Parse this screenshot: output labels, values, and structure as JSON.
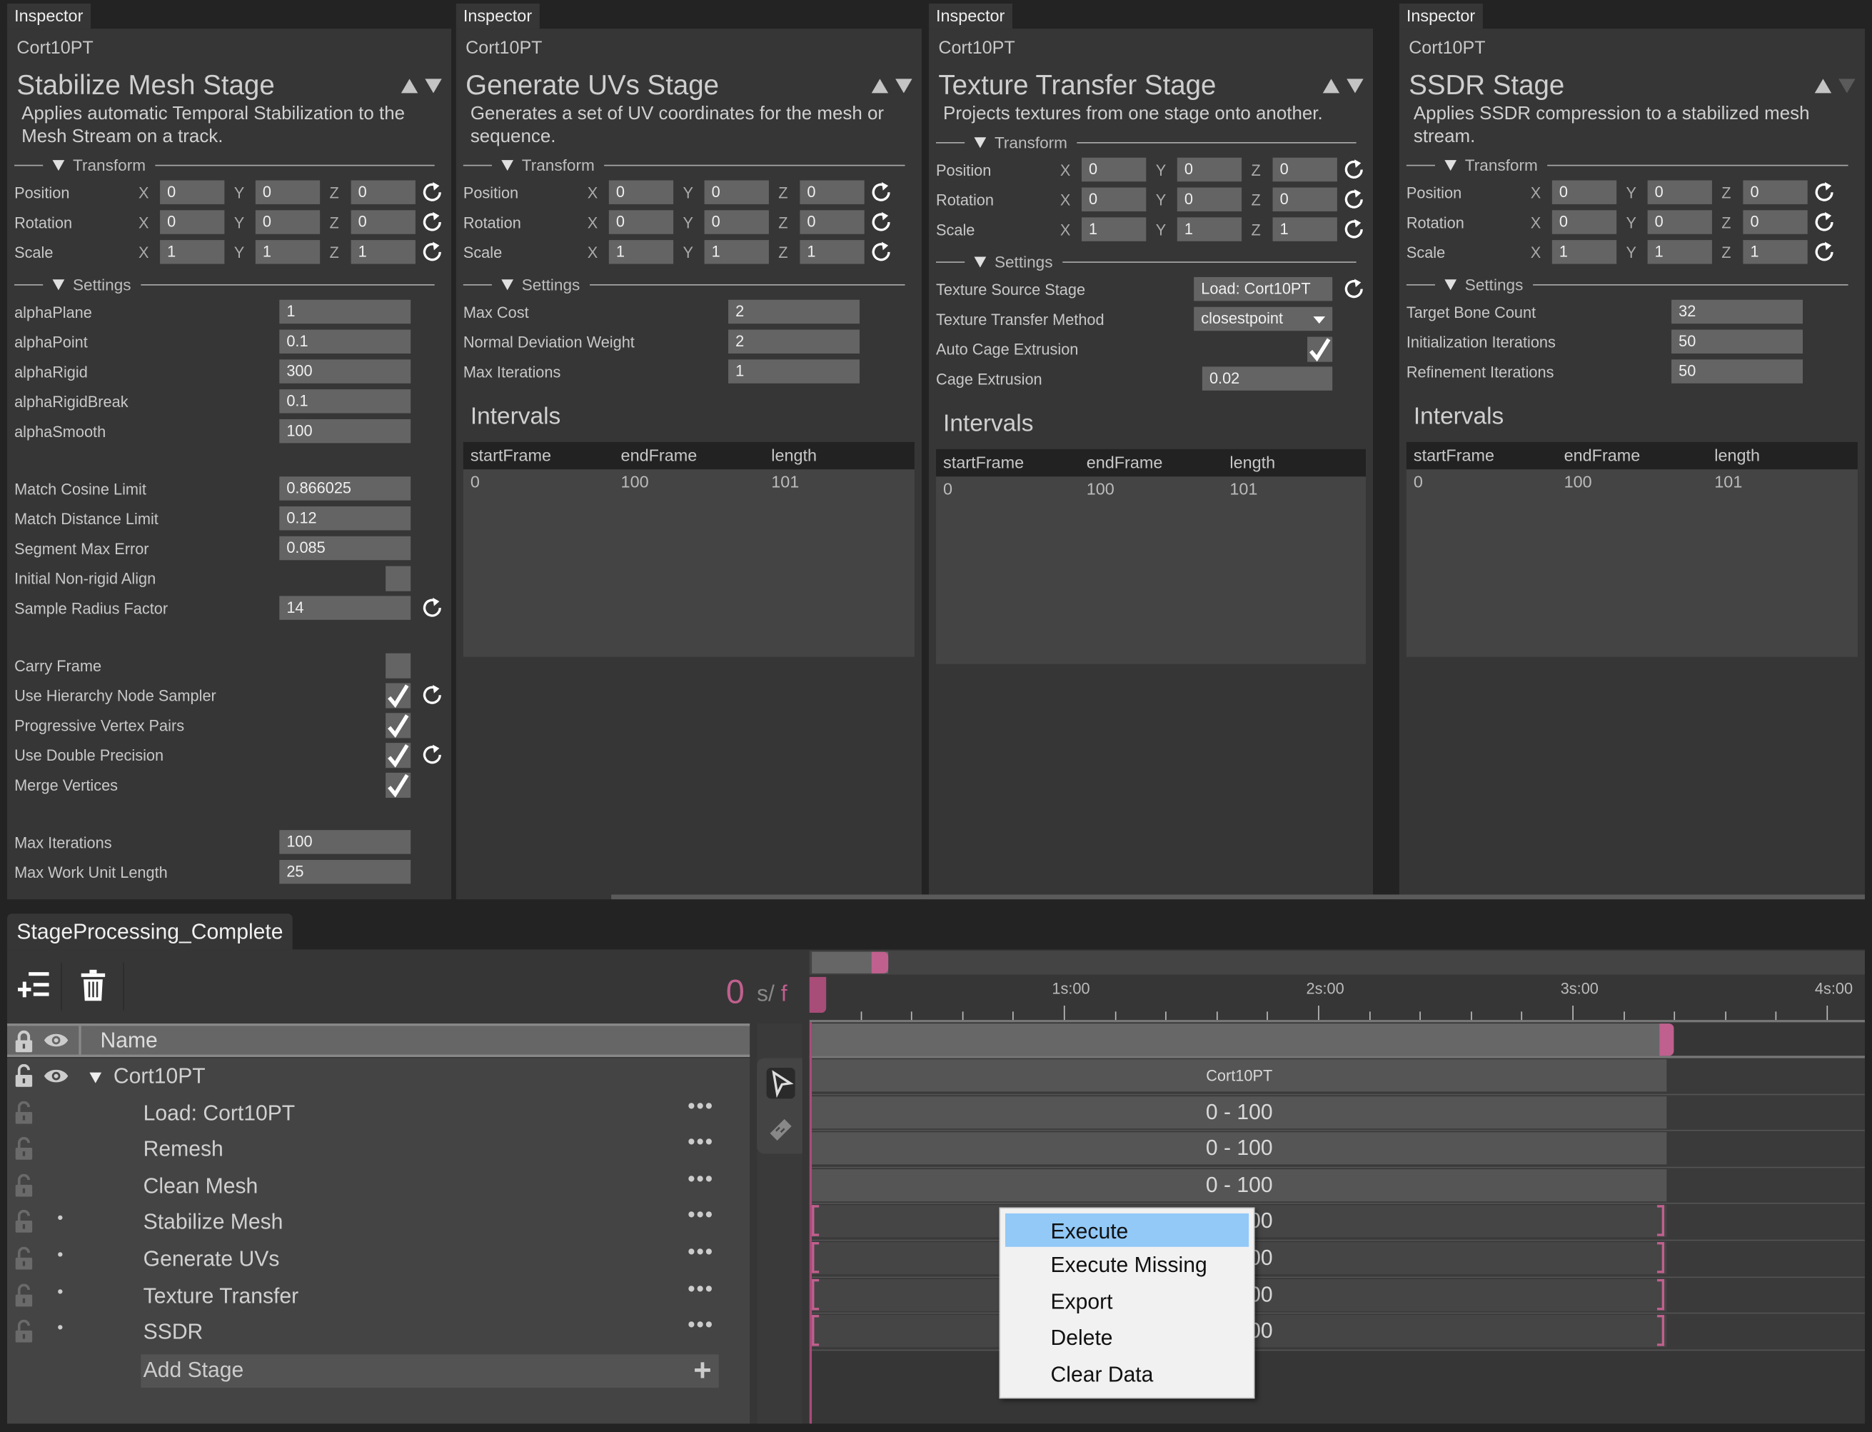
{
  "axes": [
    "X",
    "Y",
    "Z"
  ],
  "panels": [
    {
      "tab": "Inspector",
      "object": "Cort10PT",
      "title": "Stabilize Mesh Stage",
      "description": "Applies automatic Temporal Stabilization to the Mesh Stream on a track.",
      "move_down_enabled": true,
      "transform_label": "Transform",
      "settings_label": "Settings",
      "transform": [
        {
          "label": "Position",
          "x": "0",
          "y": "0",
          "z": "0"
        },
        {
          "label": "Rotation",
          "x": "0",
          "y": "0",
          "z": "0"
        },
        {
          "label": "Scale",
          "x": "1",
          "y": "1",
          "z": "1"
        }
      ],
      "settings": [
        {
          "label": "alphaPlane",
          "type": "text",
          "value": "1"
        },
        {
          "label": "alphaPoint",
          "type": "text",
          "value": "0.1"
        },
        {
          "label": "alphaRigid",
          "type": "text",
          "value": "300"
        },
        {
          "label": "alphaRigidBreak",
          "type": "text",
          "value": "0.1"
        },
        {
          "label": "alphaSmooth",
          "type": "text",
          "value": "100"
        },
        {
          "type": "gap"
        },
        {
          "label": "Match Cosine Limit",
          "type": "text",
          "value": "0.866025"
        },
        {
          "label": "Match Distance Limit",
          "type": "text",
          "value": "0.12"
        },
        {
          "label": "Segment Max Error",
          "type": "text",
          "value": "0.085"
        },
        {
          "label": "Initial Non-rigid Align",
          "type": "check",
          "checked": false
        },
        {
          "label": "Sample Radius Factor",
          "type": "text",
          "value": "14",
          "reset": true
        },
        {
          "type": "gap"
        },
        {
          "label": "Carry Frame",
          "type": "check",
          "checked": false
        },
        {
          "label": "Use Hierarchy Node Sampler",
          "type": "check",
          "checked": true,
          "reset": true
        },
        {
          "label": "Progressive Vertex Pairs",
          "type": "check",
          "checked": true
        },
        {
          "label": "Use Double Precision",
          "type": "check",
          "checked": true,
          "reset": true
        },
        {
          "label": "Merge Vertices",
          "type": "check",
          "checked": true
        },
        {
          "type": "gap"
        },
        {
          "label": "Max Iterations",
          "type": "text",
          "value": "100"
        },
        {
          "label": "Max Work Unit Length",
          "type": "text",
          "value": "25"
        }
      ]
    },
    {
      "tab": "Inspector",
      "object": "Cort10PT",
      "title": "Generate UVs Stage",
      "description": "Generates a set of UV coordinates for the mesh or sequence.",
      "move_down_enabled": true,
      "transform_label": "Transform",
      "settings_label": "Settings",
      "transform": [
        {
          "label": "Position",
          "x": "0",
          "y": "0",
          "z": "0"
        },
        {
          "label": "Rotation",
          "x": "0",
          "y": "0",
          "z": "0"
        },
        {
          "label": "Scale",
          "x": "1",
          "y": "1",
          "z": "1"
        }
      ],
      "settings": [
        {
          "label": "Max Cost",
          "type": "text",
          "value": "2"
        },
        {
          "label": "Normal Deviation Weight",
          "type": "text",
          "value": "2"
        },
        {
          "label": "Max Iterations",
          "type": "text",
          "value": "1"
        }
      ],
      "intervals": {
        "title": "Intervals",
        "columns": [
          "startFrame",
          "endFrame",
          "length"
        ],
        "rows": [
          [
            "0",
            "100",
            "101"
          ]
        ]
      }
    },
    {
      "tab": "Inspector",
      "object": "Cort10PT",
      "title": "Texture Transfer Stage",
      "description": "Projects textures from one stage onto another.",
      "move_down_enabled": true,
      "transform_label": "Transform",
      "settings_label": "Settings",
      "transform": [
        {
          "label": "Position",
          "x": "0",
          "y": "0",
          "z": "0"
        },
        {
          "label": "Rotation",
          "x": "0",
          "y": "0",
          "z": "0"
        },
        {
          "label": "Scale",
          "x": "1",
          "y": "1",
          "z": "1"
        }
      ],
      "settings": [
        {
          "label": "Texture Source Stage",
          "type": "text",
          "value": "Load: Cort10PT",
          "reset": true,
          "wide": true
        },
        {
          "label": "Texture Transfer Method",
          "type": "select",
          "value": "closestpoint",
          "wide": true
        },
        {
          "label": "Auto Cage Extrusion",
          "type": "check",
          "checked": true
        },
        {
          "label": "Cage Extrusion",
          "type": "text",
          "value": "0.02"
        }
      ],
      "intervals": {
        "title": "Intervals",
        "columns": [
          "startFrame",
          "endFrame",
          "length"
        ],
        "rows": [
          [
            "0",
            "100",
            "101"
          ]
        ]
      }
    },
    {
      "tab": "Inspector",
      "object": "Cort10PT",
      "title": "SSDR Stage",
      "description": "Applies SSDR compression to a stabilized mesh stream.",
      "move_down_enabled": false,
      "transform_label": "Transform",
      "settings_label": "Settings",
      "transform": [
        {
          "label": "Position",
          "x": "0",
          "y": "0",
          "z": "0"
        },
        {
          "label": "Rotation",
          "x": "0",
          "y": "0",
          "z": "0"
        },
        {
          "label": "Scale",
          "x": "1",
          "y": "1",
          "z": "1"
        }
      ],
      "settings": [
        {
          "label": "Target Bone Count",
          "type": "text",
          "value": "32"
        },
        {
          "label": "Initialization Iterations",
          "type": "text",
          "value": "50"
        },
        {
          "label": "Refinement Iterations",
          "type": "text",
          "value": "50"
        }
      ],
      "intervals": {
        "title": "Intervals",
        "columns": [
          "startFrame",
          "endFrame",
          "length"
        ],
        "rows": [
          [
            "0",
            "100",
            "101"
          ]
        ]
      }
    }
  ],
  "sequencer": {
    "tab": "StageProcessing_Complete",
    "frame_value": "0",
    "frame_unit_s": "s/",
    "frame_unit_f": "f",
    "name_header": "Name",
    "root": "Cort10PT",
    "stages": [
      {
        "name": "Load: Cort10PT",
        "dot": false
      },
      {
        "name": "Remesh",
        "dot": false
      },
      {
        "name": "Clean Mesh",
        "dot": false
      },
      {
        "name": "Stabilize Mesh",
        "dot": true
      },
      {
        "name": "Generate UVs",
        "dot": true
      },
      {
        "name": "Texture Transfer",
        "dot": true
      },
      {
        "name": "SSDR",
        "dot": true
      }
    ],
    "more_label": "•••",
    "add_stage": "Add Stage",
    "accent": "#c0608e"
  },
  "timeline": {
    "ruler_labels": [
      "1s:00",
      "2s:00",
      "3s:00",
      "4s:00"
    ],
    "group_clip": "Cort10PT",
    "clips": [
      {
        "label": "0 - 100",
        "pending": false
      },
      {
        "label": "0 - 100",
        "pending": false
      },
      {
        "label": "0 - 100",
        "pending": false
      },
      {
        "label": "0 - 100",
        "pending": true
      },
      {
        "label": "0 - 100",
        "pending": true
      },
      {
        "label": "0 - 100",
        "pending": true
      },
      {
        "label": "0 - 100",
        "pending": true
      }
    ]
  },
  "context_menu": {
    "items": [
      "Execute",
      "Execute Missing",
      "Export",
      "Delete",
      "Clear Data"
    ],
    "highlighted": "Execute",
    "highlight_color": "#92c9f7"
  }
}
